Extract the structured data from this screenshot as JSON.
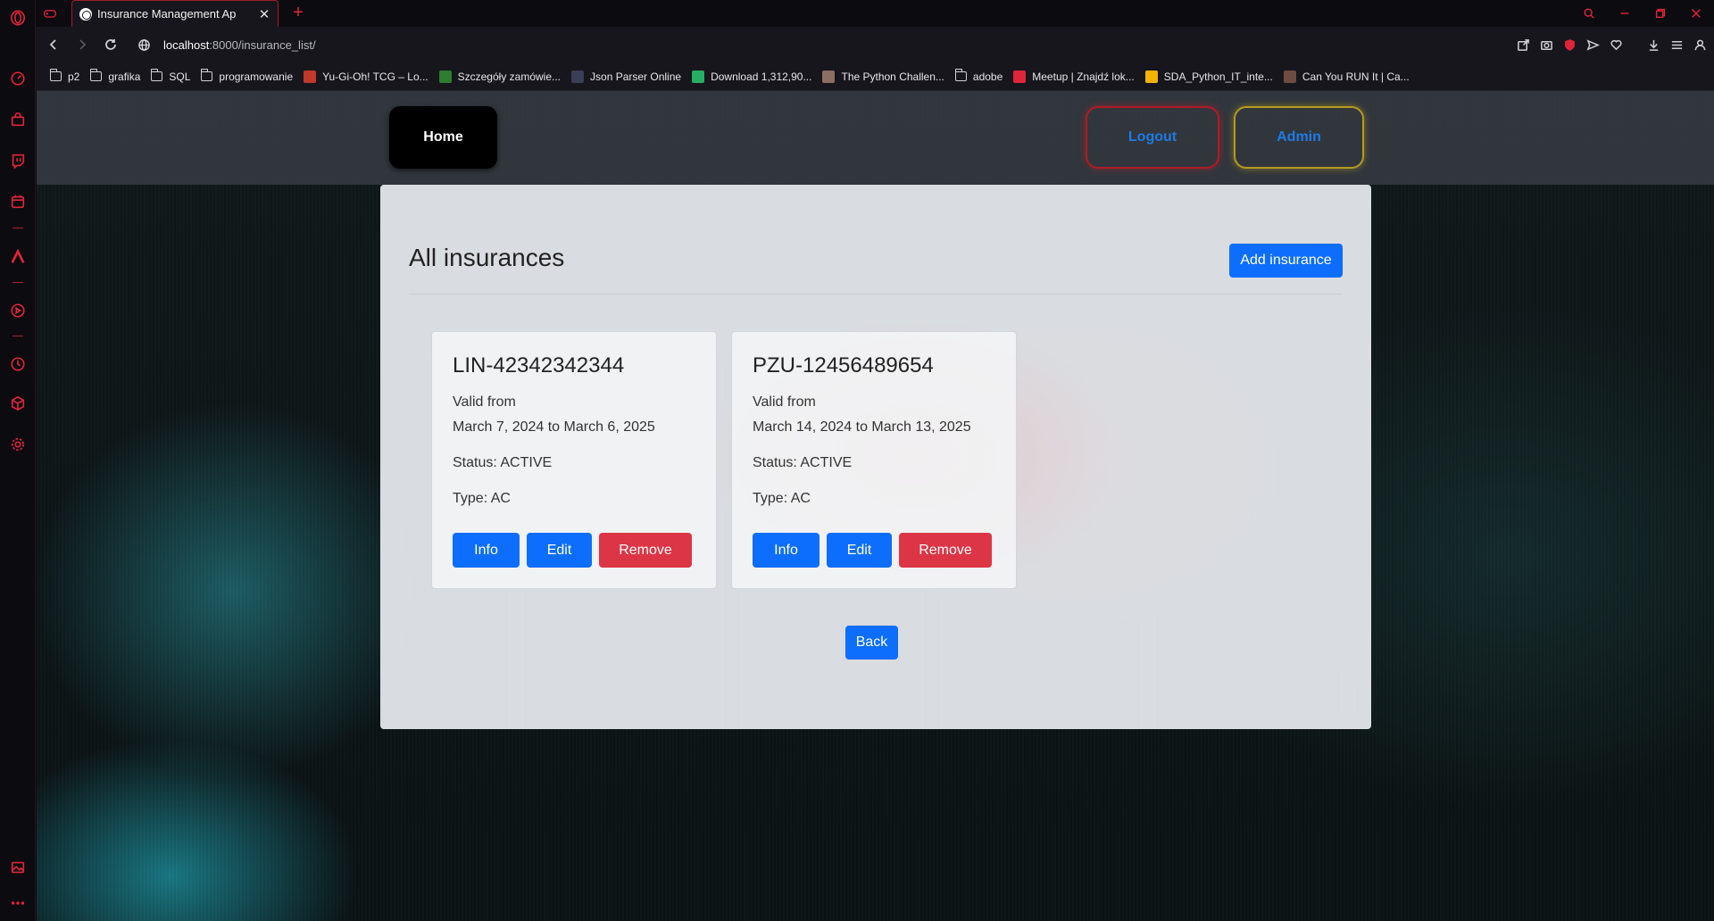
{
  "browser": {
    "tab_title": "Insurance Management Ap",
    "url_host": "localhost",
    "url_path": ":8000/insurance_list/",
    "colors": {
      "accent": "#e0253a",
      "chrome_bg": "#16161c"
    },
    "sidebar_icons": [
      "speed-dial-icon",
      "shopping-icon",
      "twitch-icon",
      "calendar-icon",
      "aria-icon",
      "player-icon",
      "history-icon",
      "extensions-icon",
      "settings-icon",
      "gallery-icon",
      "more-icon"
    ],
    "bookmarks": [
      {
        "label": "p2",
        "icon": "folder-icon"
      },
      {
        "label": "grafika",
        "icon": "folder-icon"
      },
      {
        "label": "SQL",
        "icon": "folder-icon"
      },
      {
        "label": "programowanie",
        "icon": "folder-icon"
      },
      {
        "label": "Yu-Gi-Oh! TCG – Lo...",
        "icon": "yugioh-icon",
        "color": "#c0392b"
      },
      {
        "label": "Szczegóły zamówie...",
        "icon": "allegro-icon",
        "color": "#2e7d32"
      },
      {
        "label": "Json Parser Online",
        "icon": "json-icon",
        "color": "#3a3f55"
      },
      {
        "label": "Download 1,312,90...",
        "icon": "download-site-icon",
        "color": "#27ae60"
      },
      {
        "label": "The Python Challen...",
        "icon": "python-challenge-icon",
        "color": "#8d6e63"
      },
      {
        "label": "adobe",
        "icon": "folder-icon"
      },
      {
        "label": "Meetup | Znajdź lok...",
        "icon": "meetup-icon",
        "color": "#e0253a"
      },
      {
        "label": "SDA_Python_IT_inte...",
        "icon": "sda-icon",
        "color": "#f4b400"
      },
      {
        "label": "Can You RUN It | Ca...",
        "icon": "canyourunit-icon",
        "color": "#6d4c41"
      }
    ]
  },
  "nav": {
    "home": "Home",
    "logout": "Logout",
    "admin": "Admin"
  },
  "page": {
    "title": "All insurances",
    "add_button": "Add insurance",
    "back_button": "Back",
    "cards": [
      {
        "id": "LIN-42342342344",
        "valid_label": "Valid from",
        "valid_range": "March 7, 2024 to March 6, 2025",
        "status": "Status: ACTIVE",
        "type": "Type: AC",
        "info": "Info",
        "edit": "Edit",
        "remove": "Remove"
      },
      {
        "id": "PZU-12456489654",
        "valid_label": "Valid from",
        "valid_range": "March 14, 2024 to March 13, 2025",
        "status": "Status: ACTIVE",
        "type": "Type: AC",
        "info": "Info",
        "edit": "Edit",
        "remove": "Remove"
      }
    ]
  }
}
